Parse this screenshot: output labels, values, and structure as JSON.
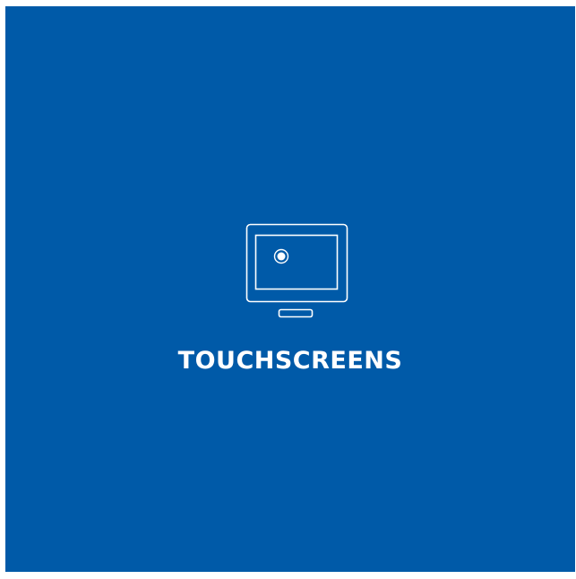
{
  "tile": {
    "title": "TOUCHSCREENS",
    "icon": "touchscreen-monitor-icon",
    "background_color": "#005aa8",
    "text_color": "#ffffff"
  }
}
